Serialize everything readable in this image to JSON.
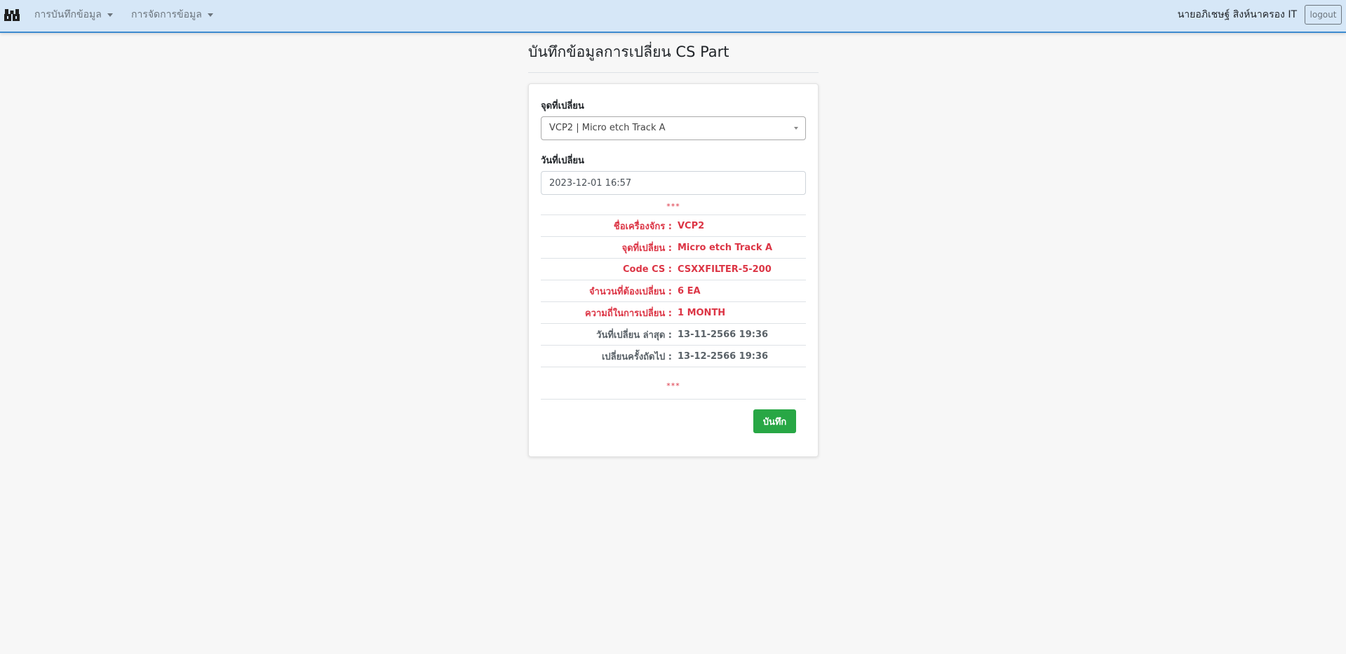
{
  "navbar": {
    "menu_record": "การบันทึกข้อมูล",
    "menu_manage": "การจัดการข้อมูล",
    "user_name": "นายอภิเชษฐ์ สิงห์นาครอง IT",
    "logout_label": "logout"
  },
  "page": {
    "title": "บันทึกข้อมูลการเปลี่ยน CS Part"
  },
  "form": {
    "point_label": "จุดที่เปลี่ยน",
    "point_selected": "VCP2 | Micro etch Track A",
    "date_label": "วันที่เปลี่ยน",
    "date_value": "2023-12-01 16:57",
    "stars": "***",
    "save_label": "บันทึก"
  },
  "info": [
    {
      "key": "ชื่อเครื่องจักร :",
      "value": "VCP2"
    },
    {
      "key": "จุดที่เปลี่ยน :",
      "value": "Micro etch Track A"
    },
    {
      "key": "Code CS :",
      "value": "CSXXFILTER-5-200"
    },
    {
      "key": "จำนวนที่ต้องเปลี่ยน :",
      "value": "6 EA"
    },
    {
      "key": "ความถี่ในการเปลี่ยน :",
      "value": "1 MONTH"
    },
    {
      "key": "วันที่เปลี่ยน ล่าสุด :",
      "value": "13-11-2566 19:36"
    },
    {
      "key": "เปลี่ยนครั้งถัดไป :",
      "value": "13-12-2566 19:36"
    }
  ],
  "colors": {
    "navbar_bg": "#d6e7f7",
    "danger": "#dc3545",
    "success": "#28a745",
    "muted": "#5a6268"
  },
  "icons": {
    "brand": "boxes-logo-icon",
    "caret": "caret-down-icon"
  }
}
